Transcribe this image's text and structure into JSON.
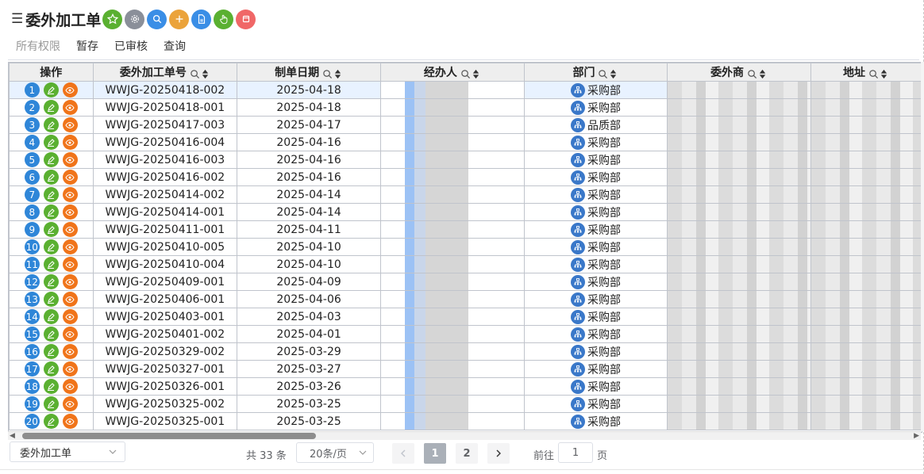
{
  "header": {
    "title": "委外加工单",
    "toolbar": [
      {
        "name": "favorite-star-icon",
        "color": "#5ab031"
      },
      {
        "name": "settings-gear-icon",
        "color": "#8a8f99"
      },
      {
        "name": "search-icon",
        "color": "#3a8ee6"
      },
      {
        "name": "add-plus-icon",
        "color": "#eba33b"
      },
      {
        "name": "export-document-icon",
        "color": "#3a8ee6"
      },
      {
        "name": "hand-pointer-icon",
        "color": "#5ab031"
      },
      {
        "name": "close-icon",
        "color": "#f06767"
      }
    ]
  },
  "tabs": [
    {
      "label": "所有权限",
      "active": true
    },
    {
      "label": "暂存",
      "active": false
    },
    {
      "label": "已审核",
      "active": false
    },
    {
      "label": "查询",
      "active": false
    }
  ],
  "table": {
    "columns": {
      "ops": "操作",
      "order_no": "委外加工单号",
      "date": "制单日期",
      "handler": "经办人",
      "dept": "部门",
      "vendor": "委外商",
      "address": "地址"
    },
    "rows": [
      {
        "n": "1",
        "order_no": "WWJG-20250418-002",
        "date": "2025-04-18",
        "dept": "采购部"
      },
      {
        "n": "2",
        "order_no": "WWJG-20250418-001",
        "date": "2025-04-18",
        "dept": "采购部"
      },
      {
        "n": "3",
        "order_no": "WWJG-20250417-003",
        "date": "2025-04-17",
        "dept": "品质部"
      },
      {
        "n": "4",
        "order_no": "WWJG-20250416-004",
        "date": "2025-04-16",
        "dept": "采购部"
      },
      {
        "n": "5",
        "order_no": "WWJG-20250416-003",
        "date": "2025-04-16",
        "dept": "采购部"
      },
      {
        "n": "6",
        "order_no": "WWJG-20250416-002",
        "date": "2025-04-16",
        "dept": "采购部"
      },
      {
        "n": "7",
        "order_no": "WWJG-20250414-002",
        "date": "2025-04-14",
        "dept": "采购部"
      },
      {
        "n": "8",
        "order_no": "WWJG-20250414-001",
        "date": "2025-04-14",
        "dept": "采购部"
      },
      {
        "n": "9",
        "order_no": "WWJG-20250411-001",
        "date": "2025-04-11",
        "dept": "采购部"
      },
      {
        "n": "10",
        "order_no": "WWJG-20250410-005",
        "date": "2025-04-10",
        "dept": "采购部"
      },
      {
        "n": "11",
        "order_no": "WWJG-20250410-004",
        "date": "2025-04-10",
        "dept": "采购部"
      },
      {
        "n": "12",
        "order_no": "WWJG-20250409-001",
        "date": "2025-04-09",
        "dept": "采购部"
      },
      {
        "n": "13",
        "order_no": "WWJG-20250406-001",
        "date": "2025-04-06",
        "dept": "采购部"
      },
      {
        "n": "14",
        "order_no": "WWJG-20250403-001",
        "date": "2025-04-03",
        "dept": "采购部"
      },
      {
        "n": "15",
        "order_no": "WWJG-20250401-002",
        "date": "2025-04-01",
        "dept": "采购部"
      },
      {
        "n": "16",
        "order_no": "WWJG-20250329-002",
        "date": "2025-03-29",
        "dept": "采购部"
      },
      {
        "n": "17",
        "order_no": "WWJG-20250327-001",
        "date": "2025-03-27",
        "dept": "采购部"
      },
      {
        "n": "18",
        "order_no": "WWJG-20250326-001",
        "date": "2025-03-26",
        "dept": "采购部"
      },
      {
        "n": "19",
        "order_no": "WWJG-20250325-002",
        "date": "2025-03-25",
        "dept": "采购部"
      },
      {
        "n": "20",
        "order_no": "WWJG-20250325-001",
        "date": "2025-03-25",
        "dept": "采购部"
      }
    ]
  },
  "footer": {
    "view_select": "委外加工单",
    "total": "共 33 条",
    "page_size": "20条/页",
    "pages": [
      "1",
      "2"
    ],
    "current_page": "1",
    "goto_label": "前往",
    "goto_value": "1",
    "goto_unit": "页"
  },
  "colors": {
    "accent": "#2f86d8",
    "edit": "#5ab031",
    "view": "#f0741a",
    "selected_row": "#e8f2ff"
  }
}
